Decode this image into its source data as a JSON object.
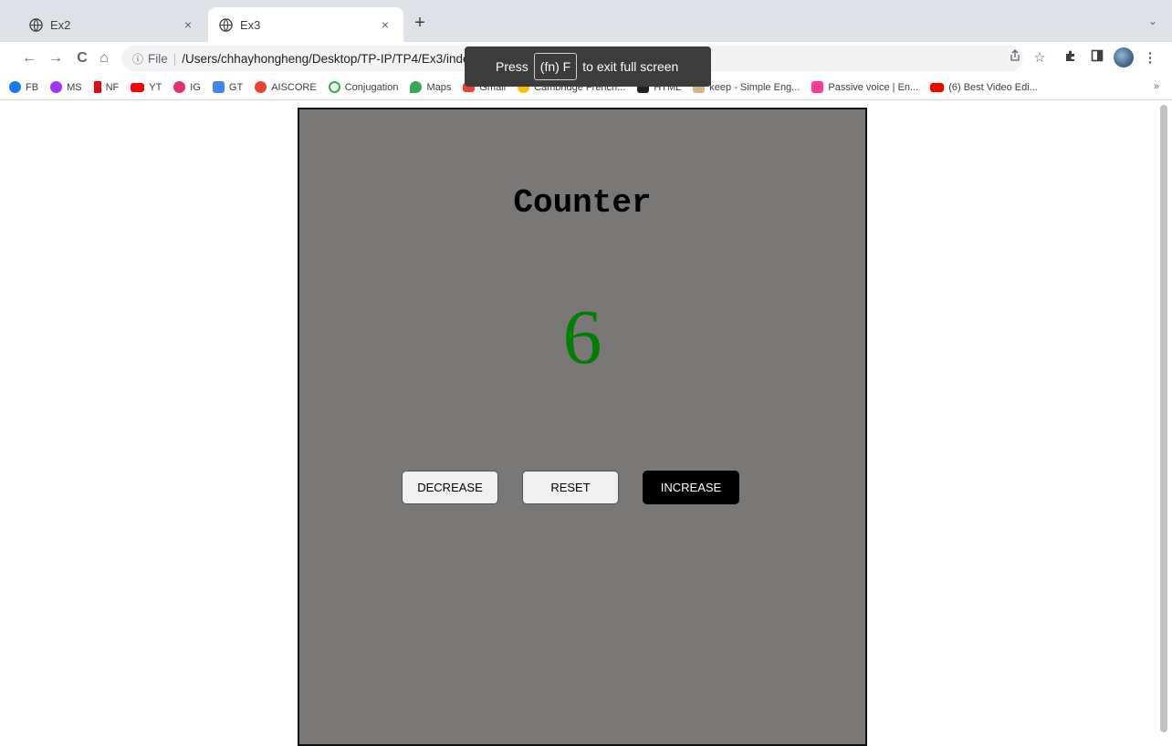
{
  "tabs": [
    {
      "label": "Ex2",
      "active": false
    },
    {
      "label": "Ex3",
      "active": true
    }
  ],
  "tab_controls": {
    "new_tab": "+",
    "close": "×",
    "tab_menu": "⌄"
  },
  "toolbar": {
    "back": "←",
    "forward": "→",
    "reload": "C",
    "home": "⌂",
    "address": {
      "info": "ⓘ",
      "scheme_label": "File",
      "separator": "|",
      "path": "/Users/chhayhongheng/Desktop/TP-IP/TP4/Ex3/index.html"
    }
  },
  "fullscreen_toast": {
    "press": "Press",
    "key": "(fn) F",
    "message": "to exit full screen"
  },
  "bookmarks": [
    {
      "label": "FB",
      "icon": "facebook-icon",
      "color": "#1877f2"
    },
    {
      "label": "MS",
      "icon": "messenger-icon",
      "color": "#a334fa"
    },
    {
      "label": "NF",
      "icon": "netflix-icon",
      "color": "#e50914"
    },
    {
      "label": "YT",
      "icon": "youtube-icon",
      "color": "#ff0000"
    },
    {
      "label": "IG",
      "icon": "instagram-icon",
      "color": "#e1306c"
    },
    {
      "label": "GT",
      "icon": "google-translate-icon",
      "color": "#4285f4"
    },
    {
      "label": "AISCORE",
      "icon": "aiscore-icon",
      "color": "#ea4335"
    },
    {
      "label": "Conjugation",
      "icon": "conjugation-icon",
      "color": "#34a853"
    },
    {
      "label": "Maps",
      "icon": "maps-icon",
      "color": "#34a853"
    },
    {
      "label": "Gmail",
      "icon": "gmail-icon",
      "color": "#ea4335"
    },
    {
      "label": "Cambridge French...",
      "icon": "cambridge-icon",
      "color": "#fbbc05"
    },
    {
      "label": "HTML",
      "icon": "html-icon",
      "color": "#202124"
    },
    {
      "label": "keep - Simple Eng...",
      "icon": "wordpress-icon",
      "color": "#d4b483"
    },
    {
      "label": "Passive voice | En...",
      "icon": "ef-icon",
      "color": "#ff3c8e"
    },
    {
      "label": "(6) Best Video Edi...",
      "icon": "youtube-icon",
      "color": "#ff0000"
    }
  ],
  "bookmarks_more": "»",
  "page": {
    "title": "Counter",
    "value": "6",
    "value_color": "#008000",
    "buttons": {
      "decrease": "DECREASE",
      "reset": "RESET",
      "increase": "INCREASE"
    }
  }
}
